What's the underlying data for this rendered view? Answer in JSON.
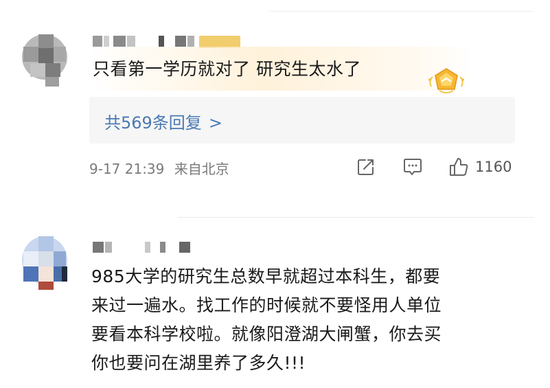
{
  "comments": [
    {
      "text_lines": [
        "只看第一学历就对了 研究生太水了"
      ],
      "replies_link": "共569条回复",
      "reply_chevron": ">",
      "date": "9-17 21:39",
      "location": "来自北京",
      "likes": "1160",
      "icons": [
        "share-icon",
        "comment-icon",
        "like-icon",
        "achievement-badge-icon"
      ],
      "accent_color": "#4a79b3"
    },
    {
      "text_lines": [
        "985大学的研究生总数早就超过本科生，都要",
        "来过一遍水。找工作的时候就不要怪用人单位",
        "要看本科学校啦。就像阳澄湖大闸蟹，你去买",
        "你也要问在湖里养了多久!!!"
      ]
    }
  ]
}
